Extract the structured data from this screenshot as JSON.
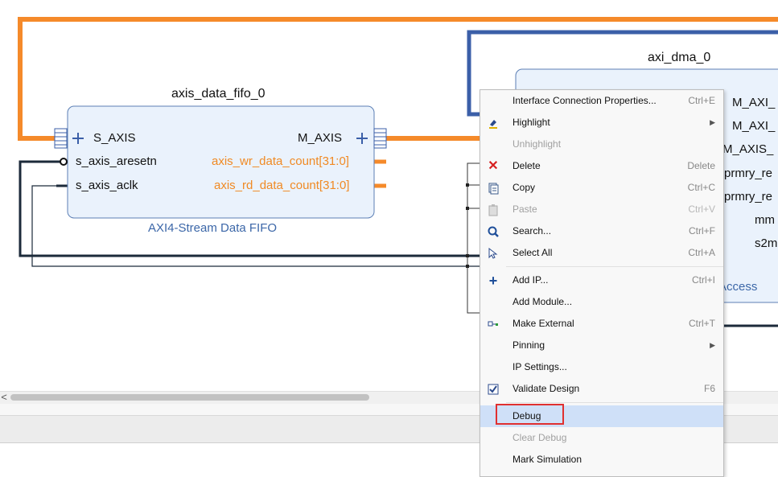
{
  "diagram": {
    "fifo": {
      "instance_name": "axis_data_fifo_0",
      "ip_name": "AXI4-Stream Data FIFO",
      "ports_left": [
        "S_AXIS",
        "s_axis_aresetn",
        "s_axis_aclk"
      ],
      "ports_right": [
        "M_AXIS",
        "axis_wr_data_count[31:0]",
        "axis_rd_data_count[31:0]"
      ]
    },
    "dma": {
      "instance_name": "axi_dma_0",
      "ip_name_partial": "Access",
      "ports_right_partial": [
        "M_AXI_",
        "M_AXI_",
        "M_AXIS_",
        "prmry_re",
        "prmry_re",
        "mm",
        "s2m"
      ]
    }
  },
  "colors": {
    "orange": "#f58a2a",
    "blue_bus": "#3b5fa8",
    "wire_dark": "#1c2a3a",
    "block_fill": "#eaf2fc",
    "block_border": "#5c7fb5",
    "highlight": "#cfe0f8",
    "callout": "#e03030"
  },
  "context_menu": {
    "items": [
      {
        "label": "Interface Connection Properties...",
        "shortcut": "Ctrl+E",
        "icon": "",
        "disabled": false
      },
      {
        "label": "Highlight",
        "shortcut": "",
        "icon": "highlight-icon",
        "submenu": true,
        "disabled": false
      },
      {
        "label": "Unhighlight",
        "shortcut": "",
        "icon": "",
        "disabled": true
      },
      {
        "label": "Delete",
        "shortcut": "Delete",
        "icon": "delete-icon",
        "disabled": false
      },
      {
        "label": "Copy",
        "shortcut": "Ctrl+C",
        "icon": "copy-icon",
        "disabled": false
      },
      {
        "label": "Paste",
        "shortcut": "Ctrl+V",
        "icon": "paste-icon",
        "disabled": true
      },
      {
        "label": "Search...",
        "shortcut": "Ctrl+F",
        "icon": "search-icon",
        "disabled": false
      },
      {
        "label": "Select All",
        "shortcut": "Ctrl+A",
        "icon": "select-all-icon",
        "disabled": false
      },
      {
        "label": "Add IP...",
        "shortcut": "Ctrl+I",
        "icon": "add-icon",
        "disabled": false
      },
      {
        "label": "Add Module...",
        "shortcut": "",
        "icon": "",
        "disabled": false
      },
      {
        "label": "Make External",
        "shortcut": "Ctrl+T",
        "icon": "make-external-icon",
        "disabled": false
      },
      {
        "label": "Pinning",
        "shortcut": "",
        "icon": "",
        "submenu": true,
        "disabled": false
      },
      {
        "label": "IP Settings...",
        "shortcut": "",
        "icon": "",
        "disabled": false
      },
      {
        "label": "Validate Design",
        "shortcut": "F6",
        "icon": "validate-icon",
        "disabled": false
      },
      {
        "label": "Debug",
        "shortcut": "",
        "icon": "",
        "disabled": false,
        "highlighted": true
      },
      {
        "label": "Clear Debug",
        "shortcut": "",
        "icon": "",
        "disabled": true
      },
      {
        "label": "Mark Simulation",
        "shortcut": "",
        "icon": "",
        "disabled": false
      }
    ]
  },
  "scrollbar": {
    "left_arrow": "<"
  }
}
